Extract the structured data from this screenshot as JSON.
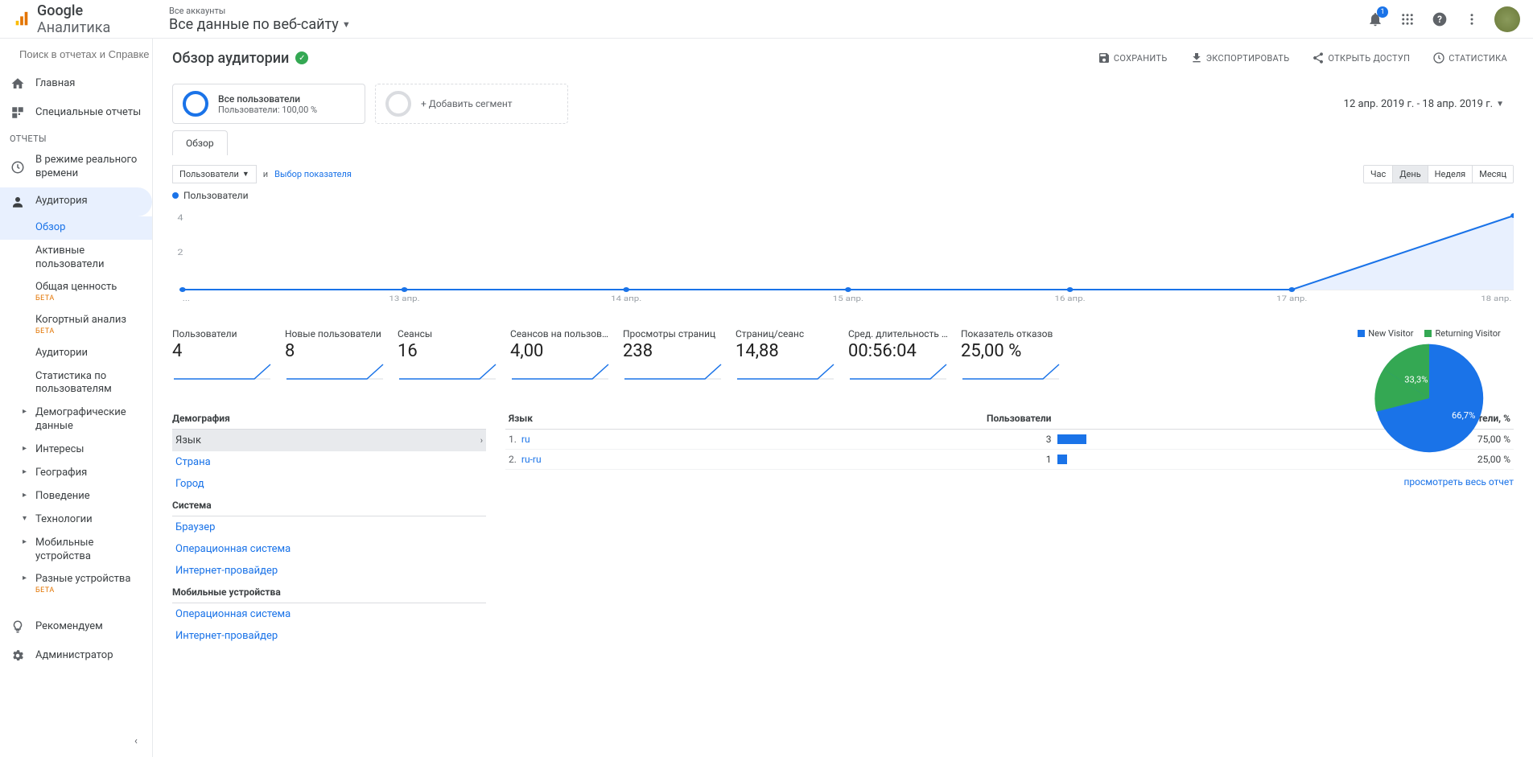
{
  "header": {
    "brand_google": "Google",
    "brand_analytics": "Аналитика",
    "all_accounts": "Все аккаунты",
    "view_name": "Все данные по веб-сайту",
    "notification_count": "1"
  },
  "search_placeholder": "Поиск в отчетах и Справке",
  "sidebar": {
    "home": "Главная",
    "customization": "Специальные отчеты",
    "reports_label": "ОТЧЕТЫ",
    "realtime": "В режиме реального времени",
    "audience": "Аудитория",
    "audience_children": {
      "overview": "Обзор",
      "active_users": "Активные пользователи",
      "lifetime_value": "Общая ценность",
      "cohort": "Когортный анализ",
      "audiences": "Аудитории",
      "user_explorer": "Статистика по пользователям",
      "demographics": "Демографические данные",
      "interests": "Интересы",
      "geo": "География",
      "behavior": "Поведение",
      "technology": "Технологии",
      "mobile": "Мобильные устройства",
      "custom": "Разные устройства"
    },
    "discover": "Рекомендуем",
    "admin": "Администратор",
    "beta": "БЕТА"
  },
  "page": {
    "title": "Обзор аудитории",
    "save": "СОХРАНИТЬ",
    "export": "ЭКСПОРТИРОВАТЬ",
    "share": "ОТКРЫТЬ ДОСТУП",
    "insights": "СТАТИСТИКА"
  },
  "segments": {
    "all_users_title": "Все пользователи",
    "all_users_sub": "Пользователи: 100,00 %",
    "add_segment": "+ Добавить сегмент"
  },
  "date_range": "12 апр. 2019 г. - 18 апр. 2019 г.",
  "tabs": {
    "overview": "Обзор"
  },
  "controls": {
    "primary_dim": "Пользователи",
    "and": "и",
    "choose_metric": "Выбор показателя",
    "hour": "Час",
    "day": "День",
    "week": "Неделя",
    "month": "Месяц"
  },
  "chart_data": {
    "type": "line",
    "series_label": "Пользователи",
    "categories": [
      "...",
      "13 апр.",
      "14 апр.",
      "15 апр.",
      "16 апр.",
      "17 апр.",
      "18 апр."
    ],
    "values": [
      0,
      0,
      0,
      0,
      0,
      0,
      4
    ],
    "ylim": [
      0,
      4
    ],
    "yticks": [
      2,
      4
    ]
  },
  "metrics": [
    {
      "label": "Пользователи",
      "value": "4"
    },
    {
      "label": "Новые пользователи",
      "value": "8"
    },
    {
      "label": "Сеансы",
      "value": "16"
    },
    {
      "label": "Сеансов на пользователя",
      "value": "4,00"
    },
    {
      "label": "Просмотры страниц",
      "value": "238"
    },
    {
      "label": "Страниц/сеанс",
      "value": "14,88"
    },
    {
      "label": "Сред. длительность сеанса",
      "value": "00:56:04"
    },
    {
      "label": "Показатель отказов",
      "value": "25,00 %"
    }
  ],
  "pie": {
    "legend_new": "New Visitor",
    "legend_returning": "Returning Visitor",
    "data": [
      {
        "label": "New Visitor",
        "value": 66.7,
        "text": "66,7%",
        "color": "#1a73e8"
      },
      {
        "label": "Returning Visitor",
        "value": 33.3,
        "text": "33,3%",
        "color": "#34a853"
      }
    ]
  },
  "dim_panel": {
    "demography": "Демография",
    "language": "Язык",
    "country": "Страна",
    "city": "Город",
    "system": "Система",
    "browser": "Браузер",
    "os": "Операционная система",
    "isp": "Интернет-провайдер",
    "mobile": "Мобильные устройства",
    "mobile_os": "Операционная система",
    "mobile_isp": "Интернет-провайдер"
  },
  "table": {
    "header_dim": "Язык",
    "header_users": "Пользователи",
    "header_users_pct": "Пользователи, %",
    "rows": [
      {
        "n": "1.",
        "dim": "ru",
        "users": "3",
        "pct": 75,
        "pct_text": "75,00 %"
      },
      {
        "n": "2.",
        "dim": "ru-ru",
        "users": "1",
        "pct": 25,
        "pct_text": "25,00 %"
      }
    ],
    "full_report": "просмотреть весь отчет"
  }
}
